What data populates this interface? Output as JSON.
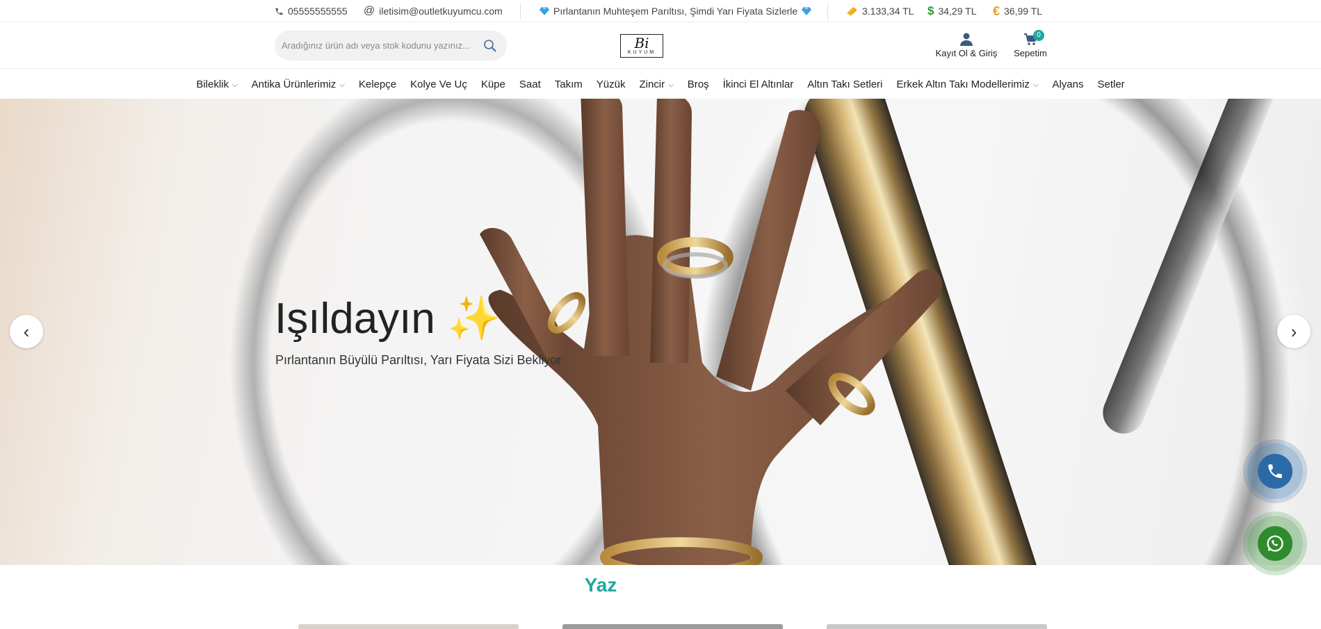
{
  "topbar": {
    "phone": "05555555555",
    "email": "iletisim@outletkuyumcu.com",
    "promo": "Pırlantanın Muhteşem Parıltısı, Şimdi Yarı Fiyata Sizlerle",
    "gold_price": "3.133,34 TL",
    "usd_price": "34,29 TL",
    "eur_price": "36,99 TL"
  },
  "header": {
    "search_placeholder": "Aradığınız ürün adı veya stok kodunu yazınız...",
    "logo_main": "Bi",
    "logo_sub": "KUYUM",
    "account_label": "Kayıt Ol & Giriş",
    "cart_label": "Sepetim",
    "cart_count": "0"
  },
  "nav": {
    "items": [
      {
        "label": "Bileklik",
        "dropdown": true
      },
      {
        "label": "Antika Ürünlerimiz",
        "dropdown": true
      },
      {
        "label": "Kelepçe",
        "dropdown": false
      },
      {
        "label": "Kolye Ve Uç",
        "dropdown": false
      },
      {
        "label": "Küpe",
        "dropdown": false
      },
      {
        "label": "Saat",
        "dropdown": false
      },
      {
        "label": "Takım",
        "dropdown": false
      },
      {
        "label": "Yüzük",
        "dropdown": false
      },
      {
        "label": "Zincir",
        "dropdown": true
      },
      {
        "label": "Broş",
        "dropdown": false
      },
      {
        "label": "İkinci El Altınlar",
        "dropdown": false
      },
      {
        "label": "Altın Takı Setleri",
        "dropdown": false
      },
      {
        "label": "Erkek Altın Takı Modellerimiz",
        "dropdown": true
      },
      {
        "label": "Alyans",
        "dropdown": false
      },
      {
        "label": "Setler",
        "dropdown": false
      }
    ]
  },
  "hero": {
    "title": "Işıldayın ✨",
    "subtitle": "Pırlantanın Büyülü Parıltısı, Yarı Fiyata Sizi Bekliyor"
  },
  "section": {
    "title": "Yaz"
  },
  "colors": {
    "accent": "#1fa89f",
    "phone_button": "#2b6aa6",
    "whatsapp_button": "#2e8b2e"
  }
}
